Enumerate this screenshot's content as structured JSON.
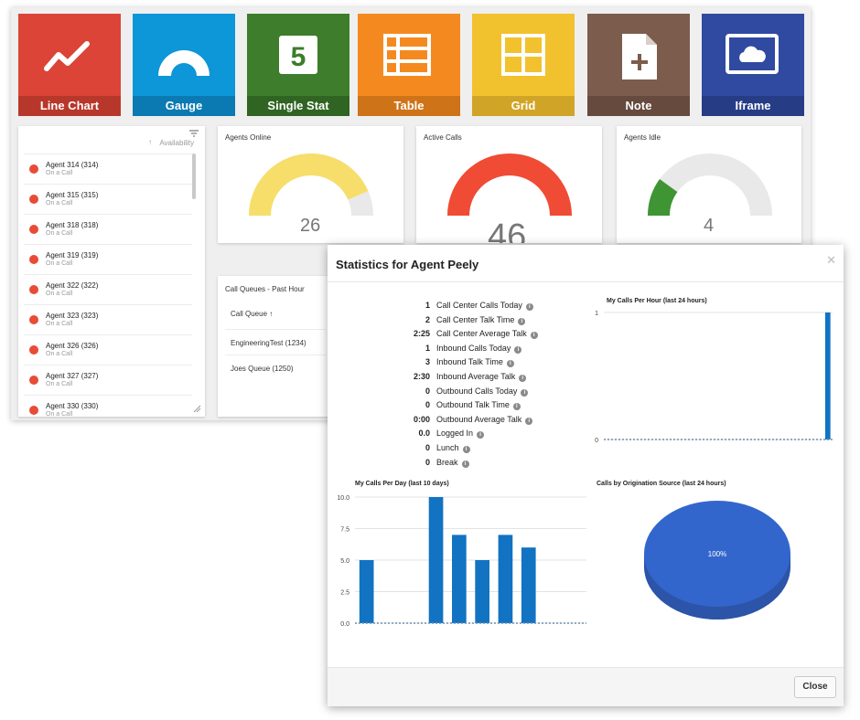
{
  "tiles": [
    {
      "label": "Line Chart",
      "icon": "line-chart-icon",
      "color": "#db4437",
      "band": "#b8372b"
    },
    {
      "label": "Gauge",
      "icon": "gauge-icon",
      "color": "#0d96d8",
      "band": "#0b7ab2"
    },
    {
      "label": "Single Stat",
      "icon": "single-stat-icon",
      "color": "#3d7d2b",
      "band": "#2f6422",
      "glyph": "5"
    },
    {
      "label": "Table",
      "icon": "table-icon",
      "color": "#f48a1f",
      "band": "#cf7319"
    },
    {
      "label": "Grid",
      "icon": "grid-icon",
      "color": "#f2c12e",
      "band": "#d0a527"
    },
    {
      "label": "Note",
      "icon": "note-icon",
      "color": "#7c5c4d",
      "band": "#654a3d"
    },
    {
      "label": "Iframe",
      "icon": "iframe-icon",
      "color": "#2f4aa0",
      "band": "#263d86"
    }
  ],
  "agents_panel": {
    "column_header": "Availability",
    "agents": [
      {
        "name": "Agent 314 (314)",
        "status": "On a Call"
      },
      {
        "name": "Agent 315 (315)",
        "status": "On a Call"
      },
      {
        "name": "Agent 318 (318)",
        "status": "On a Call"
      },
      {
        "name": "Agent 319 (319)",
        "status": "On a Call"
      },
      {
        "name": "Agent 322 (322)",
        "status": "On a Call"
      },
      {
        "name": "Agent 323 (323)",
        "status": "On a Call"
      },
      {
        "name": "Agent 326 (326)",
        "status": "On a Call"
      },
      {
        "name": "Agent 327 (327)",
        "status": "On a Call"
      },
      {
        "name": "Agent 330 (330)",
        "status": "On a Call"
      }
    ]
  },
  "gauges": [
    {
      "title": "Agents Online",
      "value": "26",
      "fraction": 0.87,
      "color": "#f7de6a",
      "track": "#e9e9e9"
    },
    {
      "title": "Active Calls",
      "value": "46",
      "fraction": 1.0,
      "color": "#f04b34",
      "track": "#e9e9e9"
    },
    {
      "title": "Agents Idle",
      "value": "4",
      "fraction": 0.2,
      "color": "#3f9533",
      "track": "#e9e9e9"
    }
  ],
  "queues": {
    "title": "Call Queues - Past Hour",
    "column": "Call Queue",
    "rows": [
      "EngineeringTest (1234)",
      "Joes Queue (1250)"
    ]
  },
  "modal": {
    "title": "Statistics for Agent Peely",
    "close_label": "Close",
    "stats": [
      {
        "value": "1",
        "label": "Call Center Calls Today"
      },
      {
        "value": "2",
        "label": "Call Center Talk Time"
      },
      {
        "value": "2:25",
        "label": "Call Center Average Talk"
      },
      {
        "value": "1",
        "label": "Inbound Calls Today"
      },
      {
        "value": "3",
        "label": "Inbound Talk Time"
      },
      {
        "value": "2:30",
        "label": "Inbound Average Talk"
      },
      {
        "value": "0",
        "label": "Outbound Calls Today"
      },
      {
        "value": "0",
        "label": "Outbound Talk Time"
      },
      {
        "value": "0:00",
        "label": "Outbound Average Talk"
      },
      {
        "value": "0.0",
        "label": "Logged In"
      },
      {
        "value": "0",
        "label": "Lunch"
      },
      {
        "value": "0",
        "label": "Break"
      }
    ]
  },
  "chart_data": [
    {
      "type": "bar",
      "title": "My Calls Per Hour (last 24 hours)",
      "ylim": [
        0,
        1
      ],
      "yticks": [
        "0",
        "1"
      ],
      "values": [
        0,
        0,
        0,
        0,
        0,
        0,
        0,
        0,
        0,
        0,
        0,
        0,
        0,
        0,
        0,
        0,
        0,
        0,
        0,
        0,
        0,
        0,
        0,
        1
      ],
      "color": "#1273c2"
    },
    {
      "type": "bar",
      "title": "My Calls Per Day (last 10 days)",
      "ylim": [
        0,
        10
      ],
      "yticks": [
        "0.0",
        "2.5",
        "5.0",
        "7.5",
        "10.0"
      ],
      "values": [
        5,
        0,
        0,
        10,
        7,
        5,
        7,
        6,
        0,
        0
      ],
      "color": "#1273c2"
    },
    {
      "type": "pie",
      "title": "Calls by Origination Source (last 24 hours)",
      "slices": [
        {
          "value": 100,
          "label": "100%",
          "color": "#3366cc"
        }
      ]
    }
  ]
}
